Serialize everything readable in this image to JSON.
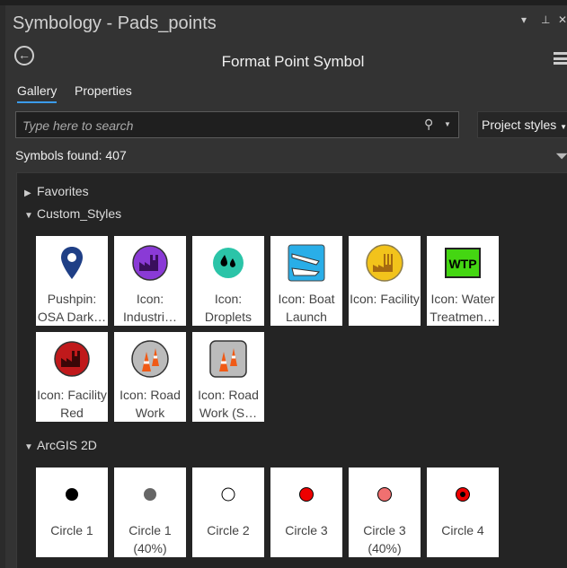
{
  "window": {
    "title": "Symbology - Pads_points"
  },
  "header": {
    "title": "Format Point Symbol"
  },
  "tabs": [
    {
      "label": "Gallery",
      "active": true
    },
    {
      "label": "Properties",
      "active": false
    }
  ],
  "search": {
    "placeholder": "Type here to search",
    "value": ""
  },
  "style_dropdown": {
    "selected": "Project styles"
  },
  "status": {
    "found": "Symbols found: 407"
  },
  "accent": "#3b9bea",
  "groups": [
    {
      "name": "Favorites",
      "expanded": false,
      "items": []
    },
    {
      "name": "Custom_Styles",
      "expanded": true,
      "items": [
        {
          "label": "Pushpin:\nOSA Dark…",
          "icon": "pushpin-icon"
        },
        {
          "label": "Icon:\nIndustri…",
          "icon": "industrial-icon"
        },
        {
          "label": "Icon:\nDroplets",
          "icon": "droplets-icon"
        },
        {
          "label": "Icon: Boat\nLaunch",
          "icon": "boat-launch-icon"
        },
        {
          "label": "Icon: Facility",
          "icon": "facility-icon"
        },
        {
          "label": "Icon: Water\nTreatmen…",
          "icon": "wtp-icon",
          "icon_text": "WTP"
        },
        {
          "label": "Icon: Facility\nRed",
          "icon": "facility-red-icon"
        },
        {
          "label": "Icon: Road\nWork",
          "icon": "road-work-icon"
        },
        {
          "label": "Icon: Road\nWork (S…",
          "icon": "road-work-square-icon"
        }
      ]
    },
    {
      "name": "ArcGIS 2D",
      "expanded": true,
      "items": [
        {
          "label": "Circle 1",
          "icon": "circle-black-icon"
        },
        {
          "label": "Circle 1\n(40%)",
          "icon": "circle-gray-icon"
        },
        {
          "label": "Circle 2",
          "icon": "circle-white-icon"
        },
        {
          "label": "Circle 3",
          "icon": "circle-red-icon"
        },
        {
          "label": "Circle 3\n(40%)",
          "icon": "circle-pink-icon"
        },
        {
          "label": "Circle 4",
          "icon": "circle-target-icon"
        }
      ]
    }
  ]
}
